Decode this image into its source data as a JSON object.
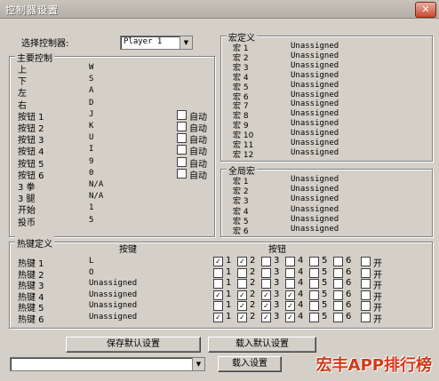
{
  "window": {
    "title": "控制器设置",
    "close_glyph": "✕"
  },
  "controller": {
    "label": "选择控制器:",
    "selected": "Player 1"
  },
  "main_keys": {
    "title": "主要控制",
    "rows": [
      {
        "name": "上",
        "key": "W"
      },
      {
        "name": "下",
        "key": "S"
      },
      {
        "name": "左",
        "key": "A"
      },
      {
        "name": "右",
        "key": "D"
      },
      {
        "name": "按钮 1",
        "key": "J",
        "auto": "自动"
      },
      {
        "name": "按钮 2",
        "key": "K",
        "auto": "自动"
      },
      {
        "name": "按钮 3",
        "key": "U",
        "auto": "自动"
      },
      {
        "name": "按钮 4",
        "key": "I",
        "auto": "自动"
      },
      {
        "name": "按钮 5",
        "key": "9",
        "auto": "自动"
      },
      {
        "name": "按钮 6",
        "key": "0",
        "auto": "自动"
      },
      {
        "name": "3 拳",
        "key": "N/A"
      },
      {
        "name": "3 腿",
        "key": "N/A"
      },
      {
        "name": "开始",
        "key": "1"
      },
      {
        "name": "投币",
        "key": "5"
      }
    ]
  },
  "macros": {
    "title": "宏定义",
    "rows": [
      {
        "name": "宏 1",
        "value": "Unassigned"
      },
      {
        "name": "宏 2",
        "value": "Unassigned"
      },
      {
        "name": "宏 3",
        "value": "Unassigned"
      },
      {
        "name": "宏 4",
        "value": "Unassigned"
      },
      {
        "name": "宏 5",
        "value": "Unassigned"
      },
      {
        "name": "宏 6",
        "value": "Unassigned"
      },
      {
        "name": "宏 7",
        "value": "Unassigned"
      },
      {
        "name": "宏 8",
        "value": "Unassigned"
      },
      {
        "name": "宏 9",
        "value": "Unassigned"
      },
      {
        "name": "宏 10",
        "value": "Unassigned"
      },
      {
        "name": "宏 11",
        "value": "Unassigned"
      },
      {
        "name": "宏 12",
        "value": "Unassigned"
      }
    ]
  },
  "global_macros": {
    "title": "全局宏",
    "rows": [
      {
        "name": "宏 1",
        "value": "Unassigned"
      },
      {
        "name": "宏 2",
        "value": "Unassigned"
      },
      {
        "name": "宏 3",
        "value": "Unassigned"
      },
      {
        "name": "宏 4",
        "value": "Unassigned"
      },
      {
        "name": "宏 5",
        "value": "Unassigned"
      },
      {
        "name": "宏 6",
        "value": "Unassigned"
      }
    ]
  },
  "hotkeys": {
    "title": "热键定义",
    "key_header": "按键",
    "buttons_header": "按钮",
    "button_labels": [
      "1",
      "2",
      "3",
      "4",
      "5",
      "6",
      "开"
    ],
    "rows": [
      {
        "name": "热键 1",
        "key": "L",
        "checks": [
          true,
          true,
          false,
          false,
          false,
          false,
          false
        ]
      },
      {
        "name": "热键 2",
        "key": "O",
        "checks": [
          false,
          false,
          false,
          false,
          false,
          false,
          false
        ]
      },
      {
        "name": "热键 3",
        "key": "Unassigned",
        "checks": [
          false,
          false,
          false,
          false,
          false,
          false,
          false
        ]
      },
      {
        "name": "热键 4",
        "key": "Unassigned",
        "checks": [
          true,
          true,
          true,
          true,
          false,
          false,
          false
        ]
      },
      {
        "name": "热键 5",
        "key": "Unassigned",
        "checks": [
          false,
          true,
          true,
          true,
          false,
          false,
          false
        ]
      },
      {
        "name": "热键 6",
        "key": "Unassigned",
        "checks": [
          true,
          true,
          true,
          true,
          false,
          false,
          false
        ]
      }
    ]
  },
  "buttons": {
    "save_default": "保存默认设置",
    "load_default": "载入默认设置",
    "load": "载入设置"
  },
  "combo": {
    "value": ""
  },
  "watermark": "宏丰APP排行榜"
}
